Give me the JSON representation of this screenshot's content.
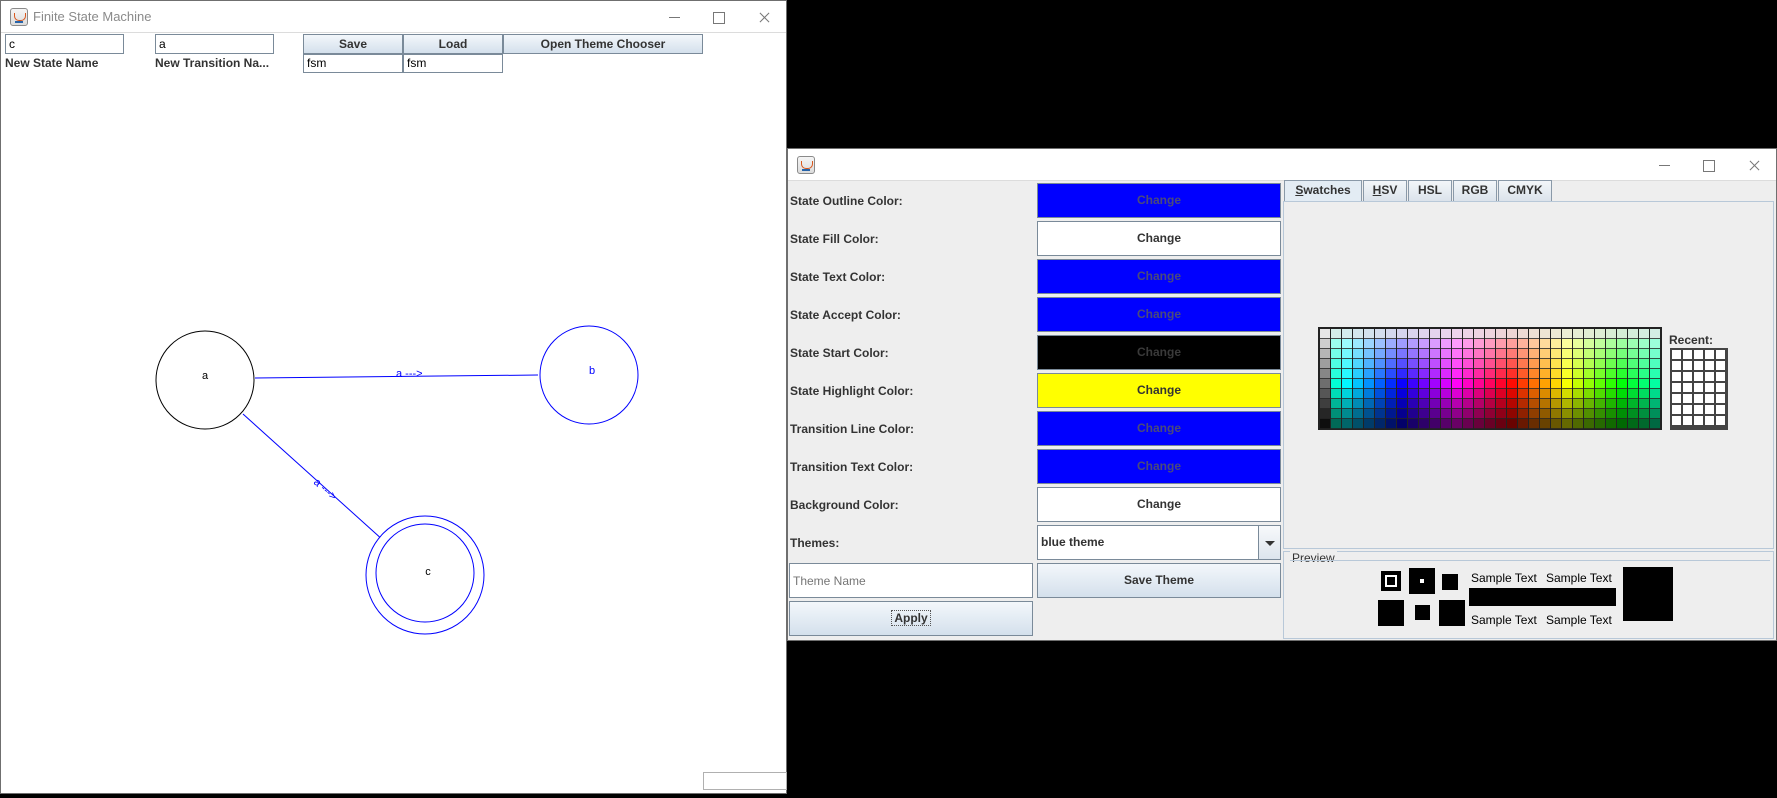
{
  "fsm_window": {
    "title": "Finite State Machine",
    "state_name_value": "c",
    "transition_name_value": "a",
    "save_label": "Save",
    "load_label": "Load",
    "theme_chooser_label": "Open Theme Chooser",
    "new_state_label": "New State Name",
    "new_transition_label": "New Transition Na...",
    "save_file_value": "fsm",
    "load_file_value": "fsm",
    "status_value": "",
    "graph": {
      "states": [
        {
          "name": "a",
          "color": "#000000",
          "accept": false
        },
        {
          "name": "b",
          "color": "#0000ff",
          "accept": false
        },
        {
          "name": "c",
          "color": "#0000ff",
          "accept": true
        }
      ],
      "transitions": [
        {
          "from": "a",
          "to": "b",
          "label": "a --->"
        },
        {
          "from": "a",
          "to": "c",
          "label": "a --->"
        }
      ]
    }
  },
  "theme_window": {
    "title": "",
    "rows": [
      {
        "label": "State Outline Color:",
        "button": "Change",
        "color": "#0000ff",
        "text_color": "#4b4b7a"
      },
      {
        "label": "State Fill Color:",
        "button": "Change",
        "color": "#ffffff",
        "text_color": "#333333"
      },
      {
        "label": "State Text Color:",
        "button": "Change",
        "color": "#0000ff",
        "text_color": "#4b4b7a"
      },
      {
        "label": "State Accept Color:",
        "button": "Change",
        "color": "#0000ff",
        "text_color": "#4b4b7a"
      },
      {
        "label": "State Start Color:",
        "button": "Change",
        "color": "#000000",
        "text_color": "#3a3a3a"
      },
      {
        "label": "State Highlight Color:",
        "button": "Change",
        "color": "#ffff00",
        "text_color": "#333333"
      },
      {
        "label": "Transition Line Color:",
        "button": "Change",
        "color": "#0000ff",
        "text_color": "#4b4b7a"
      },
      {
        "label": "Transition Text Color:",
        "button": "Change",
        "color": "#0000ff",
        "text_color": "#4b4b7a"
      },
      {
        "label": "Background Color:",
        "button": "Change",
        "color": "#ffffff",
        "text_color": "#333333"
      }
    ],
    "themes_label": "Themes:",
    "themes_selected": "blue theme",
    "theme_name_placeholder": "Theme Name",
    "save_theme_label": "Save Theme",
    "apply_label": "Apply",
    "tabs": [
      {
        "label": "Swatches",
        "mnemonic": "S",
        "rest": "watches"
      },
      {
        "label": "HSV",
        "mnemonic": "H",
        "rest": "SV"
      },
      {
        "label": "HSL",
        "mnemonic": "",
        "rest": "HSL"
      },
      {
        "label": "RGB",
        "mnemonic": "",
        "rest": "RGB"
      },
      {
        "label": "CMYK",
        "mnemonic": "",
        "rest": "CMYK"
      }
    ],
    "recent_label": "Recent:",
    "preview_label": "Preview",
    "sample_text": "Sample Text"
  }
}
